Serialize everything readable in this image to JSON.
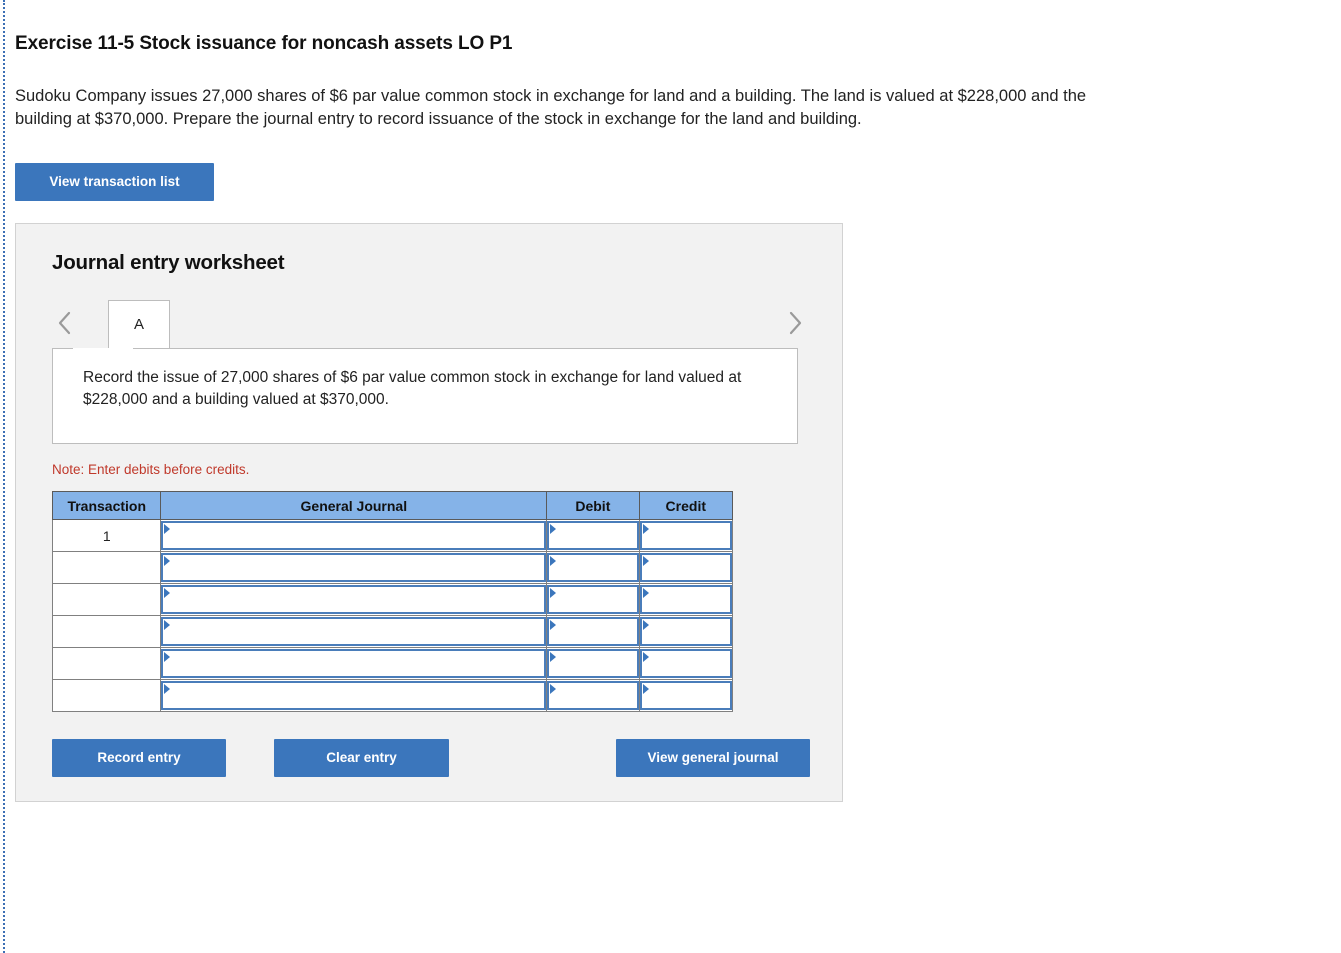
{
  "page": {
    "title": "Exercise 11-5 Stock issuance for noncash assets LO P1",
    "description": "Sudoku Company issues 27,000 shares of $6 par value common stock in exchange for land and a building. The land is valued at $228,000 and the building at $370,000. Prepare the journal entry to record issuance of the stock in exchange for the land and building."
  },
  "toolbar": {
    "view_transaction_list_label": "View transaction list"
  },
  "worksheet": {
    "heading": "Journal entry worksheet",
    "tabs": [
      {
        "label": "A",
        "active": true
      }
    ],
    "nav": {
      "prev_icon": "chevron-left-icon",
      "next_icon": "chevron-right-icon"
    },
    "instruction": "Record the issue of 27,000 shares of $6 par value common stock in exchange for land valued at $228,000 and a building valued at $370,000.",
    "note": "Note: Enter debits before credits.",
    "table": {
      "columns": [
        "Transaction",
        "General Journal",
        "Debit",
        "Credit"
      ],
      "rows": [
        {
          "transaction": "1",
          "general_journal": "",
          "debit": "",
          "credit": ""
        },
        {
          "transaction": "",
          "general_journal": "",
          "debit": "",
          "credit": ""
        },
        {
          "transaction": "",
          "general_journal": "",
          "debit": "",
          "credit": ""
        },
        {
          "transaction": "",
          "general_journal": "",
          "debit": "",
          "credit": ""
        },
        {
          "transaction": "",
          "general_journal": "",
          "debit": "",
          "credit": ""
        },
        {
          "transaction": "",
          "general_journal": "",
          "debit": "",
          "credit": ""
        }
      ]
    },
    "buttons": {
      "record_entry_label": "Record entry",
      "clear_entry_label": "Clear entry",
      "view_general_journal_label": "View general journal"
    }
  },
  "colors": {
    "button_blue": "#3b76bc",
    "table_header_blue": "#85b3e8",
    "input_border_blue": "#4a7dba",
    "note_red": "#c0392b",
    "panel_gray": "#f2f2f2",
    "page_edge_blue": "#3b6fb5"
  }
}
